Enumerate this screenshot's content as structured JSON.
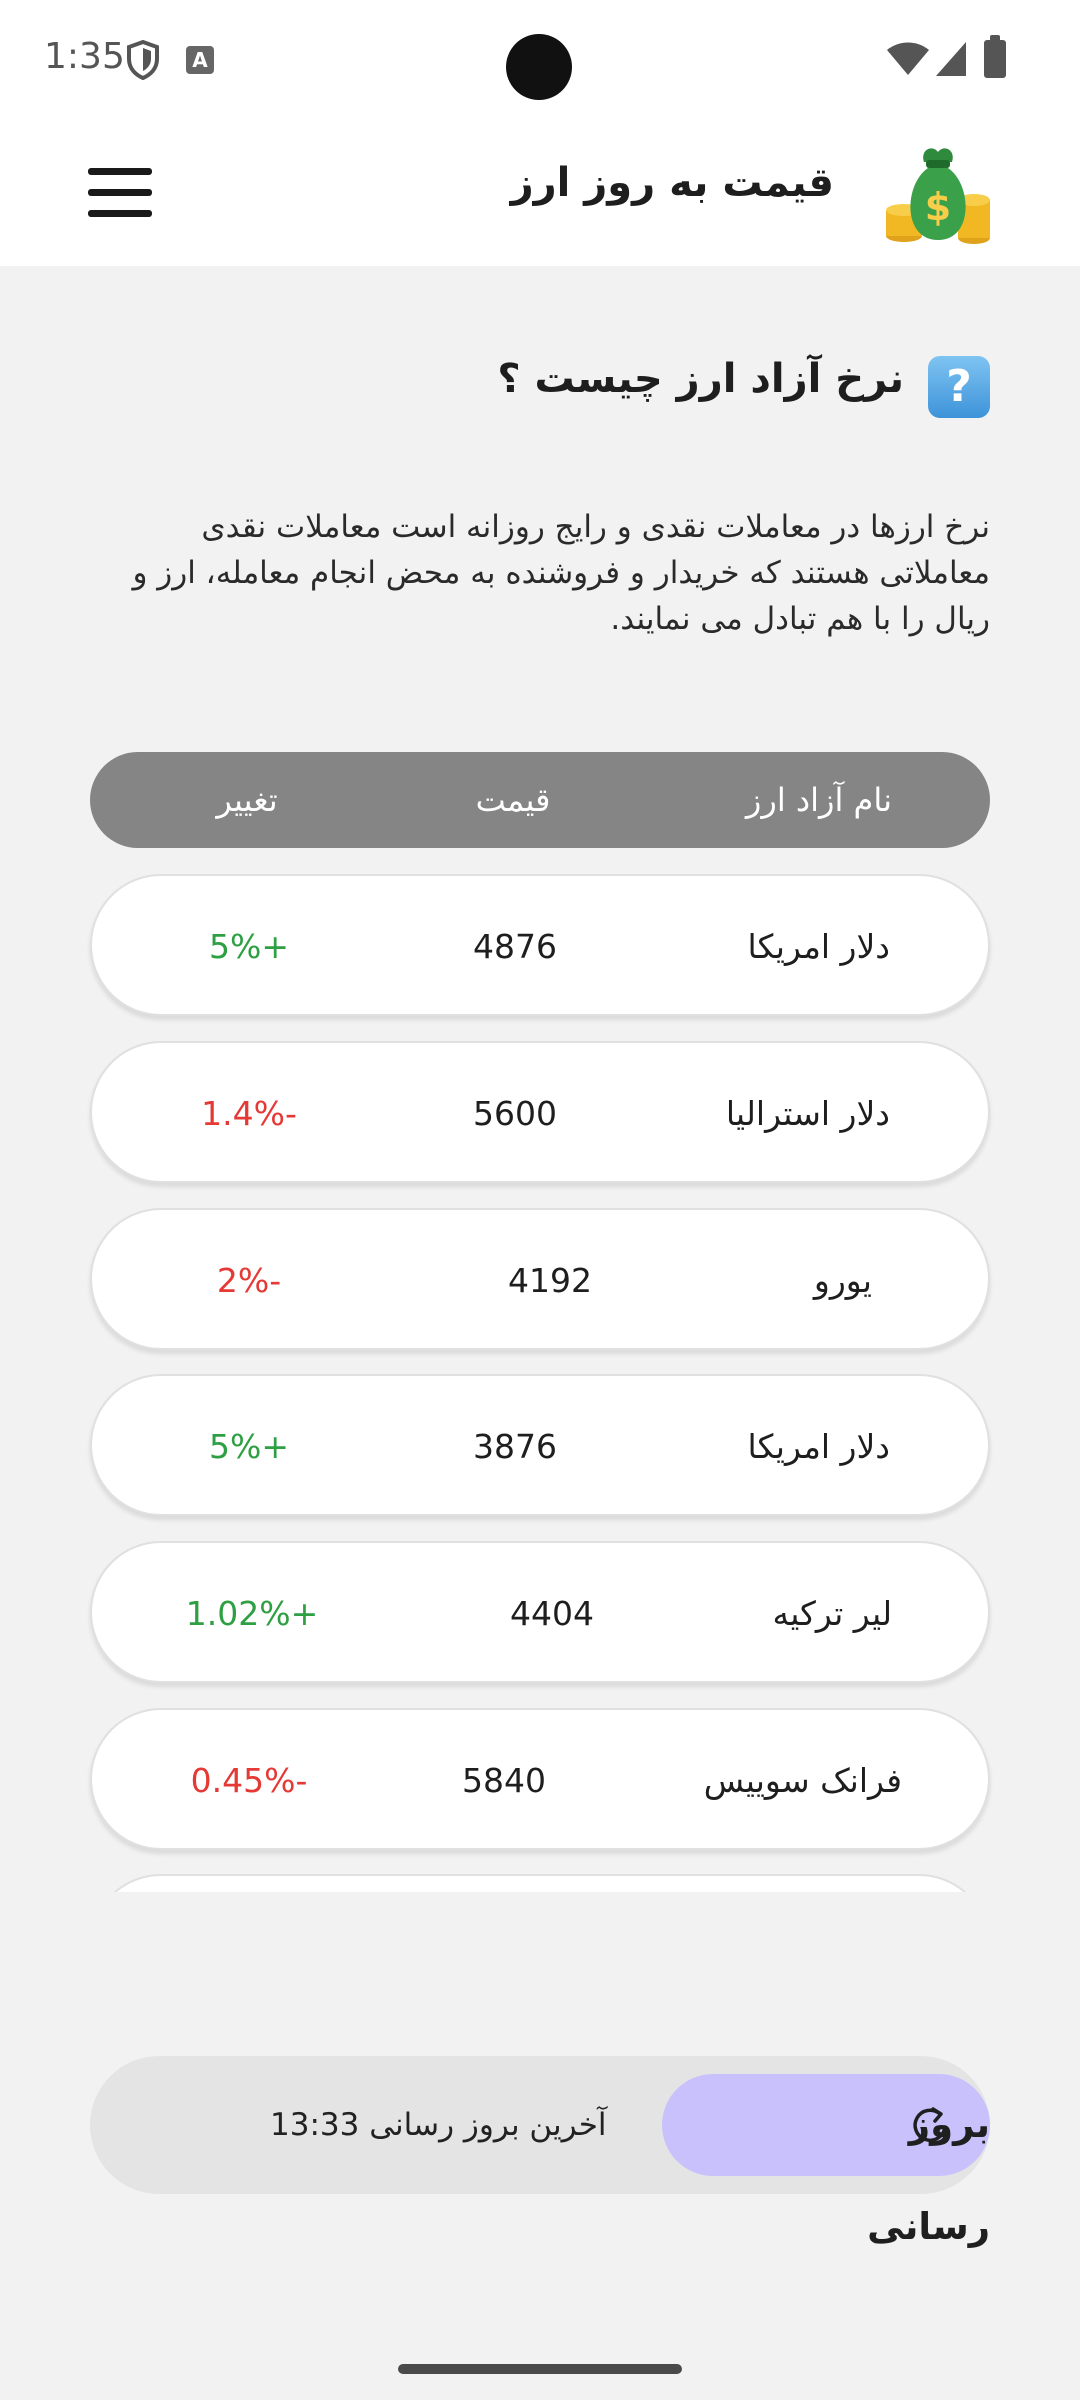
{
  "status_bar": {
    "time": "1:35"
  },
  "app_bar": {
    "title": "قیمت به روز ارز",
    "logo_icon": "money-bag-icon",
    "menu_icon": "hamburger-menu-icon"
  },
  "section": {
    "title": "نرخ آزاد ارز چیست ؟",
    "icon": "question-icon",
    "icon_glyph": "?",
    "description": "نرخ ارزها در معاملات نقدی و رایج روزانه است معاملات نقدی معاملاتی هستند که خریدار و فروشنده به محض انجام معامله، ارز و ریال را با هم تبادل می نمایند."
  },
  "table": {
    "headers": {
      "name": "نام آزاد ارز",
      "price": "قیمت",
      "change": "تغییر"
    },
    "rows": [
      {
        "name": "دلار امریکا",
        "price": "4876",
        "change": "5%+",
        "trend": "up"
      },
      {
        "name": "دلار استرالیا",
        "price": "5600",
        "change": "1.4%-",
        "trend": "down"
      },
      {
        "name": "یورو",
        "price": "4192",
        "change": "2%-",
        "trend": "down"
      },
      {
        "name": "دلار امریکا",
        "price": "3876",
        "change": "5%+",
        "trend": "up"
      },
      {
        "name": "لیر ترکیه",
        "price": "4404",
        "change": "1.02%+",
        "trend": "up"
      },
      {
        "name": "فرانک سوییس",
        "price": "5840",
        "change": "0.45%-",
        "trend": "down"
      }
    ]
  },
  "update_bar": {
    "last_update_label": "آخرین بروز رسانی 13:33",
    "refresh_label": "بروز رسانی",
    "refresh_icon": "refresh-icon"
  },
  "colors": {
    "positive": "#2ea043",
    "negative": "#e53935",
    "header_bg": "#858585",
    "refresh_bg": "#c8c1fb"
  }
}
